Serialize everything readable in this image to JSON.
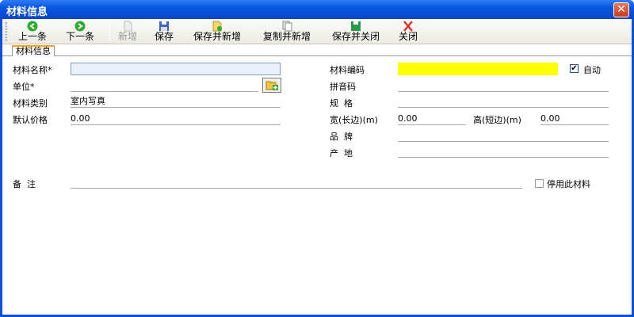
{
  "window": {
    "title": "材料信息",
    "close_glyph": "✕"
  },
  "toolbar": {
    "buttons": [
      {
        "label": "上一条",
        "icon": "arrow-left-icon",
        "enabled": true
      },
      {
        "label": "下一条",
        "icon": "arrow-right-icon",
        "enabled": true
      },
      {
        "label": "新增",
        "icon": "new-doc-icon",
        "enabled": false
      },
      {
        "label": "保存",
        "icon": "save-icon",
        "enabled": true
      },
      {
        "label": "保存并新增",
        "icon": "save-new-icon",
        "enabled": true
      },
      {
        "label": "复制并新增",
        "icon": "copy-new-icon",
        "enabled": true
      },
      {
        "label": "保存并关闭",
        "icon": "save-close-icon",
        "enabled": true
      },
      {
        "label": "关闭",
        "icon": "close-icon",
        "enabled": true
      }
    ]
  },
  "tabs": [
    {
      "label": "材料信息",
      "active": true
    }
  ],
  "form": {
    "name": {
      "label": "材料名称*",
      "value": ""
    },
    "unit": {
      "label": "单位*",
      "value": ""
    },
    "category": {
      "label": "材料类别",
      "value": "室内写真"
    },
    "price": {
      "label": "默认价格",
      "value": "0.00"
    },
    "code": {
      "label": "材料编码",
      "value": ""
    },
    "auto": {
      "label": "自动",
      "checked": true,
      "glyph": "✔"
    },
    "pinyin": {
      "label": "拼音码",
      "value": ""
    },
    "spec": {
      "label": "规  格",
      "value": ""
    },
    "width": {
      "label": "宽(长边)(m)",
      "value": "0.00"
    },
    "height": {
      "label": "高(短边)(m)",
      "value": "0.00"
    },
    "brand": {
      "label": "品  牌",
      "value": ""
    },
    "origin": {
      "label": "产  地",
      "value": ""
    },
    "remark": {
      "label": "备  注",
      "value": ""
    },
    "disable": {
      "label": "停用此材料",
      "checked": false
    }
  },
  "colors": {
    "titlebar": "#0a56e0",
    "code_field": "#ffff00",
    "tab_accent": "#f6a61e"
  }
}
